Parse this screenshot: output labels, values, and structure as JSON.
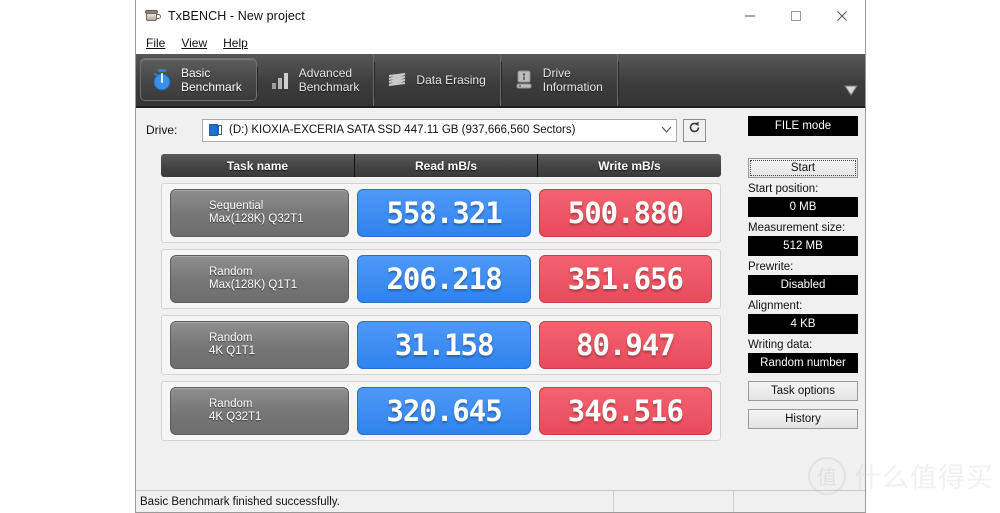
{
  "window": {
    "title": "TxBENCH - New project",
    "app_icon": "coffee-cup-icon",
    "controls": {
      "minimize": "minimize-icon",
      "maximize": "maximize-icon",
      "close": "close-icon"
    }
  },
  "menu": {
    "items": [
      "File",
      "View",
      "Help"
    ]
  },
  "tabs": [
    {
      "label": "Basic\nBenchmark",
      "icon": "stopwatch-icon",
      "active": true
    },
    {
      "label": "Advanced\nBenchmark",
      "icon": "bar-chart-icon",
      "active": false
    },
    {
      "label": "Data Erasing",
      "icon": "shred-icon",
      "active": false
    },
    {
      "label": "Drive\nInformation",
      "icon": "hard-drive-icon",
      "active": false
    }
  ],
  "tabs_overflow_icon": "chevron-down-icon",
  "drive": {
    "label": "Drive:",
    "selected": "(D:) KIOXIA-EXCERIA SATA SSD  447.11 GB (937,666,560 Sectors)",
    "glyph": "drive-icon",
    "dropdown_icon": "chevron-down-icon",
    "refresh_icon": "refresh-icon"
  },
  "benchmark": {
    "headers": [
      "Task name",
      "Read mB/s",
      "Write mB/s"
    ],
    "rows": [
      {
        "task_line1": "Sequential",
        "task_line2": "Max(128K) Q32T1",
        "read": "558.321",
        "write": "500.880"
      },
      {
        "task_line1": "Random",
        "task_line2": "Max(128K) Q1T1",
        "read": "206.218",
        "write": "351.656"
      },
      {
        "task_line1": "Random",
        "task_line2": "4K Q1T1",
        "read": "31.158",
        "write": "80.947"
      },
      {
        "task_line1": "Random",
        "task_line2": "4K Q32T1",
        "read": "320.645",
        "write": "346.516"
      }
    ]
  },
  "panel": {
    "mode_button": "FILE mode",
    "start_button": "Start",
    "start_position_label": "Start position:",
    "start_position_value": "0 MB",
    "measurement_size_label": "Measurement size:",
    "measurement_size_value": "512 MB",
    "prewrite_label": "Prewrite:",
    "prewrite_value": "Disabled",
    "alignment_label": "Alignment:",
    "alignment_value": "4 KB",
    "writing_data_label": "Writing data:",
    "writing_data_value": "Random number",
    "task_options_button": "Task options",
    "history_button": "History"
  },
  "statusbar": {
    "message": "Basic Benchmark finished successfully."
  },
  "watermark": {
    "logo_char": "值",
    "text": "什么值得买"
  },
  "colors": {
    "read": "#2f83ee",
    "write": "#e84b5b",
    "header_dark": "#434343",
    "task_grey": "#767676",
    "black_field": "#000000"
  }
}
